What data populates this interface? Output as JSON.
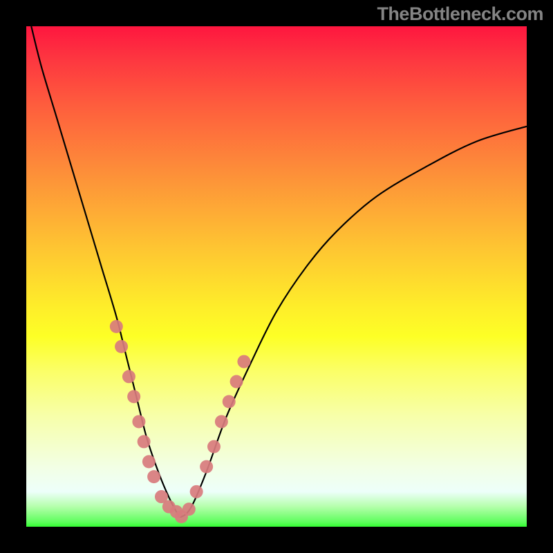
{
  "watermark": "TheBottleneck.com",
  "chart_data": {
    "type": "line",
    "title": "",
    "xlabel": "",
    "ylabel": "",
    "xlim": [
      0,
      100
    ],
    "ylim": [
      0,
      100
    ],
    "x": [
      1,
      3,
      6,
      9,
      12,
      15,
      18,
      20,
      22,
      24,
      26,
      28,
      30,
      31,
      33,
      36,
      40,
      45,
      50,
      56,
      62,
      70,
      80,
      90,
      100
    ],
    "values": [
      100,
      92,
      82,
      72,
      62,
      52,
      42,
      34,
      26,
      18,
      12,
      7,
      3,
      2,
      4,
      11,
      22,
      33,
      43,
      52,
      59,
      66,
      72,
      77,
      80
    ],
    "markers": {
      "x": [
        18,
        19,
        20.5,
        21.5,
        22.5,
        23.5,
        24.5,
        25.5,
        27,
        28.5,
        30,
        31,
        32.5,
        34,
        36,
        37.5,
        39,
        40.5,
        42,
        43.5
      ],
      "values": [
        40,
        36,
        30,
        26,
        21,
        17,
        13,
        10,
        6,
        4,
        3,
        2,
        3.5,
        7,
        12,
        16,
        21,
        25,
        29,
        33
      ]
    }
  }
}
